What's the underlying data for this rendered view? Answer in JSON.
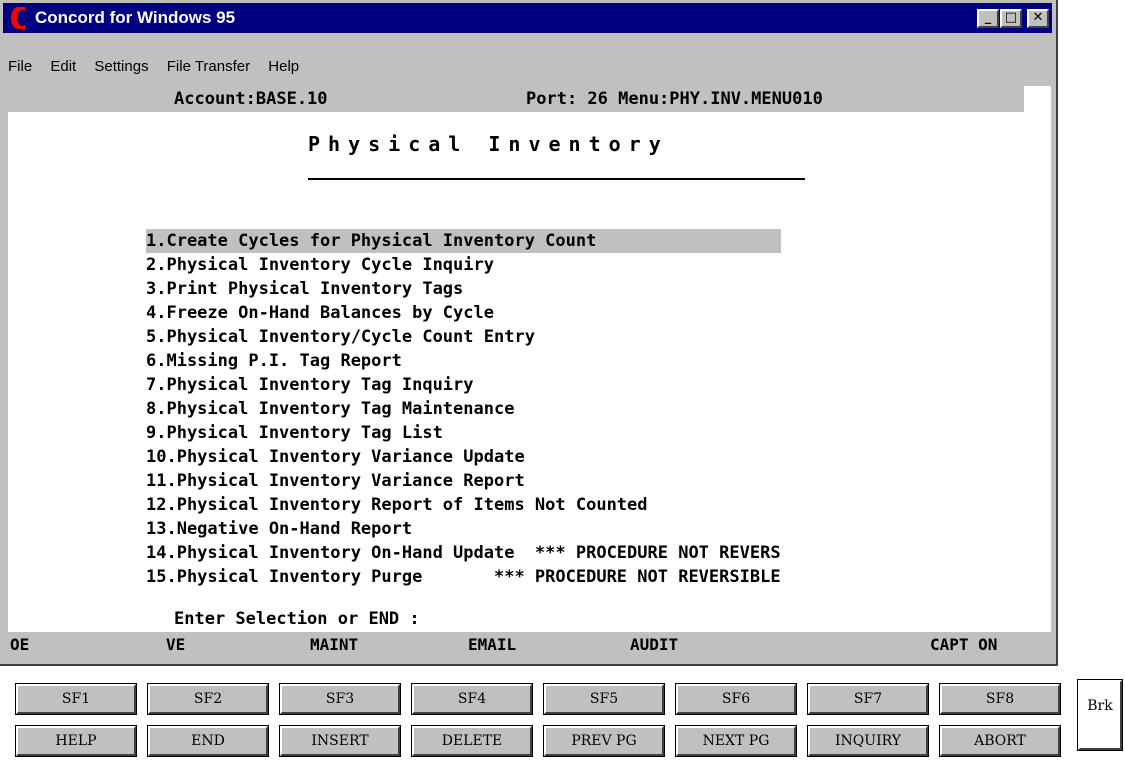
{
  "window": {
    "title": "Concord for Windows 95",
    "controls": {
      "minimize": "_",
      "maximize": "□",
      "close": "✕"
    }
  },
  "menubar": [
    "File",
    "Edit",
    "Settings",
    "File Transfer",
    "Help"
  ],
  "header": {
    "account": "Account:BASE.10",
    "port_menu": "Port: 26 Menu:PHY.INV.MENU010"
  },
  "screen_title": "Physical Inventory",
  "menu_items": [
    "1.Create Cycles for Physical Inventory Count",
    "2.Physical Inventory Cycle Inquiry",
    "3.Print Physical Inventory Tags",
    "4.Freeze On-Hand Balances by Cycle",
    "5.Physical Inventory/Cycle Count Entry",
    "6.Missing P.I. Tag Report",
    "7.Physical Inventory Tag Inquiry",
    "8.Physical Inventory Tag Maintenance",
    "9.Physical Inventory Tag List",
    "10.Physical Inventory Variance Update",
    "11.Physical Inventory Variance Report",
    "12.Physical Inventory Report of Items Not Counted",
    "13.Negative On-Hand Report",
    "14.Physical Inventory On-Hand Update  *** PROCEDURE NOT REVERS",
    "15.Physical Inventory Purge       *** PROCEDURE NOT REVERSIBLE"
  ],
  "selected_index": 0,
  "prompt": "Enter Selection or END :",
  "function_bar": [
    "OE",
    "VE",
    "MAINT",
    "EMAIL",
    "AUDIT",
    "CAPT ON"
  ],
  "softkeys_top": [
    "SF1",
    "SF2",
    "SF3",
    "SF4",
    "SF5",
    "SF6",
    "SF7",
    "SF8"
  ],
  "softkeys_bottom": [
    "HELP",
    "END",
    "INSERT",
    "DELETE",
    "PREV PG",
    "NEXT PG",
    "INQUIRY",
    "ABORT"
  ],
  "break_key": "Brk"
}
